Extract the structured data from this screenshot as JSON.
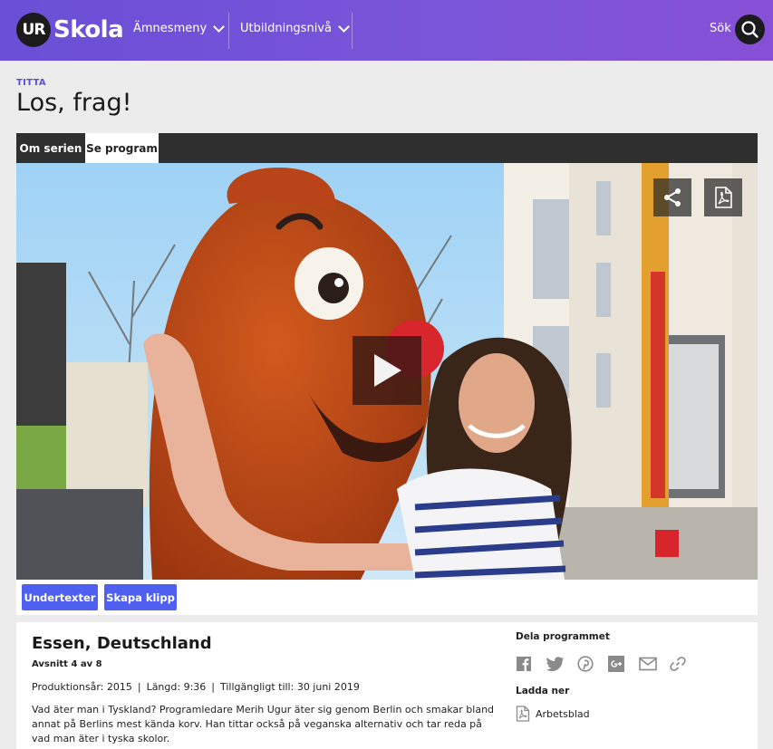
{
  "header": {
    "logo_mark": "UR",
    "logo_text": "Skola",
    "nav": [
      {
        "label": "Ämnesmeny"
      },
      {
        "label": "Utbildningsnivå"
      }
    ],
    "search_label": "Sök"
  },
  "page": {
    "kicker": "TITTA",
    "title": "Los, frag!"
  },
  "tabs": [
    {
      "label": "Om serien",
      "active": false
    },
    {
      "label": "Se program",
      "active": true
    }
  ],
  "video_controls": {
    "icons": [
      "share-icon",
      "pdf-icon",
      "play-icon"
    ]
  },
  "actions": {
    "subtitles_label": "Undertexter",
    "create_clip_label": "Skapa klipp"
  },
  "episode": {
    "title": "Essen, Deutschland",
    "episode_label": "Avsnitt 4 av 8",
    "production_year": "Produktionsår: 2015",
    "length": "Längd: 9:36",
    "available": "Tillgängligt till: 30 juni 2019",
    "description": "Vad äter man i Tyskland? Programledare Merih Ugur äter sig genom Berlin och smakar bland annat på Berlins mest kända korv. Han tittar också på veganska alternativ och tar reda på vad man äter i tyska skolor."
  },
  "share": {
    "heading": "Dela programmet",
    "icons": [
      "facebook-icon",
      "twitter-icon",
      "pinterest-icon",
      "googleplus-icon",
      "email-icon",
      "link-icon"
    ]
  },
  "download": {
    "heading": "Ladda ner",
    "item_label": "Arbetsblad"
  },
  "colors": {
    "header_gradient_start": "#6a4fd6",
    "accent_button": "#4f5ff0",
    "tabbar": "#2f2f2f"
  }
}
